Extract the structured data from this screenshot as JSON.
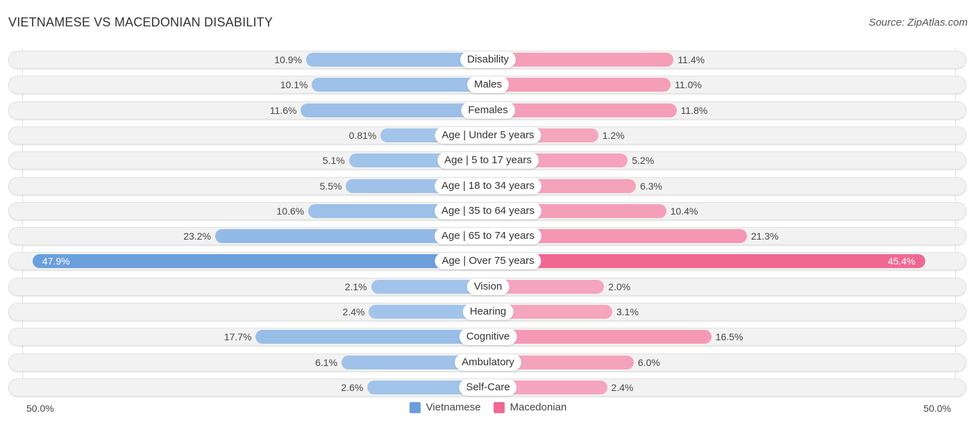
{
  "chart_data": {
    "type": "bar",
    "title": "VIETNAMESE VS MACEDONIAN DISABILITY",
    "source": "Source: ZipAtlas.com",
    "categories": [
      "Disability",
      "Males",
      "Females",
      "Age | Under 5 years",
      "Age | 5 to 17 years",
      "Age | 18 to 34 years",
      "Age | 35 to 64 years",
      "Age | 65 to 74 years",
      "Age | Over 75 years",
      "Vision",
      "Hearing",
      "Cognitive",
      "Ambulatory",
      "Self-Care"
    ],
    "series": [
      {
        "name": "Vietnamese",
        "color": "#6a9fdc",
        "values": [
          10.9,
          10.1,
          11.6,
          0.81,
          5.1,
          5.5,
          10.6,
          23.2,
          47.9,
          2.1,
          2.4,
          17.7,
          6.1,
          2.6
        ],
        "labels": [
          "10.9%",
          "10.1%",
          "11.6%",
          "0.81%",
          "5.1%",
          "5.5%",
          "10.6%",
          "23.2%",
          "47.9%",
          "2.1%",
          "2.4%",
          "17.7%",
          "6.1%",
          "2.6%"
        ]
      },
      {
        "name": "Macedonian",
        "color": "#f06892",
        "values": [
          11.4,
          11.0,
          11.8,
          1.2,
          5.2,
          6.3,
          10.4,
          21.3,
          45.4,
          2.0,
          3.1,
          16.5,
          6.0,
          2.4
        ],
        "labels": [
          "11.4%",
          "11.0%",
          "11.8%",
          "1.2%",
          "5.2%",
          "6.3%",
          "10.4%",
          "21.3%",
          "45.4%",
          "2.0%",
          "3.1%",
          "16.5%",
          "6.0%",
          "2.4%"
        ]
      }
    ],
    "axis": {
      "left_label": "50.0%",
      "right_label": "50.0%",
      "range": [
        0,
        50
      ]
    },
    "legend_position": "bottom-center",
    "orientation": "horizontal-diverging"
  }
}
